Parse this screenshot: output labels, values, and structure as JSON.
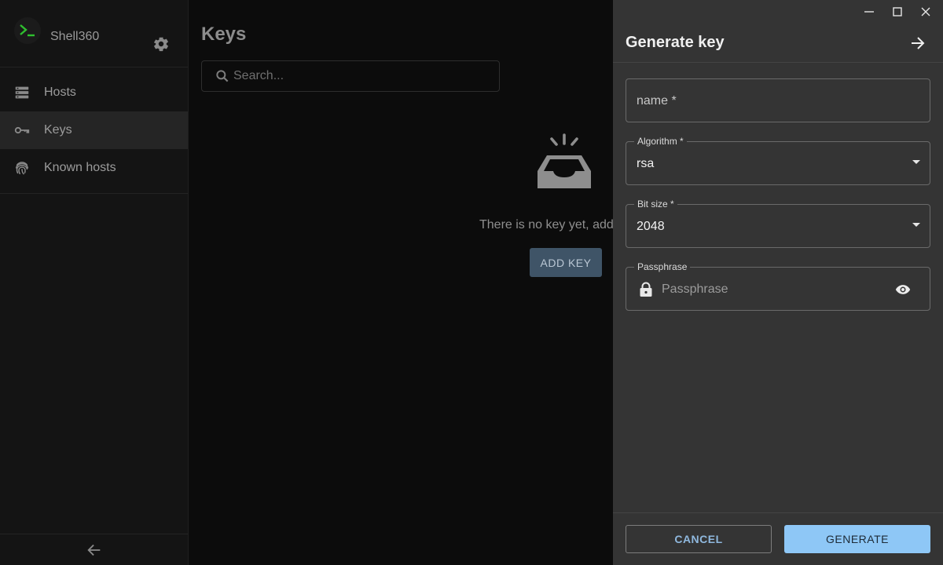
{
  "app": {
    "name": "Shell360"
  },
  "sidebar": {
    "items": [
      {
        "label": "Hosts",
        "icon": "server-icon",
        "active": false
      },
      {
        "label": "Keys",
        "icon": "key-icon",
        "active": true
      },
      {
        "label": "Known hosts",
        "icon": "fingerprint-icon",
        "active": false
      }
    ]
  },
  "main": {
    "title": "Keys",
    "search": {
      "placeholder": "Search..."
    },
    "empty": {
      "text": "There is no key yet, add",
      "button": "ADD KEY"
    }
  },
  "drawer": {
    "title": "Generate key",
    "fields": {
      "name": {
        "placeholder": "name *"
      },
      "algorithm": {
        "label": "Algorithm *",
        "value": "rsa"
      },
      "bit_size": {
        "label": "Bit size *",
        "value": "2048"
      },
      "passphrase": {
        "label": "Passphrase",
        "placeholder": "Passphrase"
      }
    },
    "buttons": {
      "cancel": "CANCEL",
      "generate": "GENERATE"
    }
  },
  "colors": {
    "accent": "#8ec7f6",
    "logo_green": "#2fbf2f",
    "drawer_bg": "#343434",
    "sidebar_bg": "#141414"
  }
}
